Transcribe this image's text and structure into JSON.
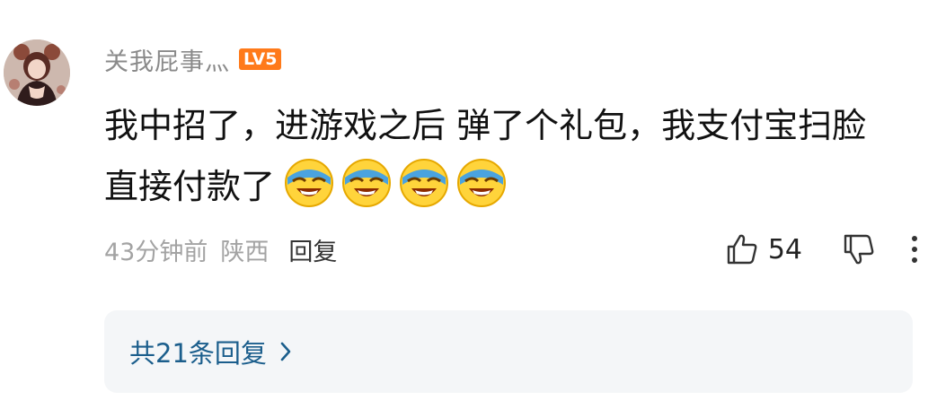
{
  "comment": {
    "username": "关我屁事灬",
    "level_badge": "LV5",
    "text_line1": "我中招了，进游戏之后 弹了个礼包，我支付宝扫脸",
    "text_line2": "直接付款了",
    "emojis": [
      "laughing-crying-emoji",
      "laughing-crying-emoji",
      "laughing-crying-emoji",
      "laughing-crying-emoji"
    ],
    "time_ago": "43分钟前",
    "location": "陕西",
    "reply_label": "回复",
    "like_count": "54"
  },
  "replies": {
    "label": "共21条回复"
  },
  "colors": {
    "username": "#8a8a8a",
    "level_badge": "#ff7a1a",
    "meta": "#a3a3a3",
    "replies_link": "#1b5e8c",
    "replies_bg": "#f4f6f8"
  }
}
